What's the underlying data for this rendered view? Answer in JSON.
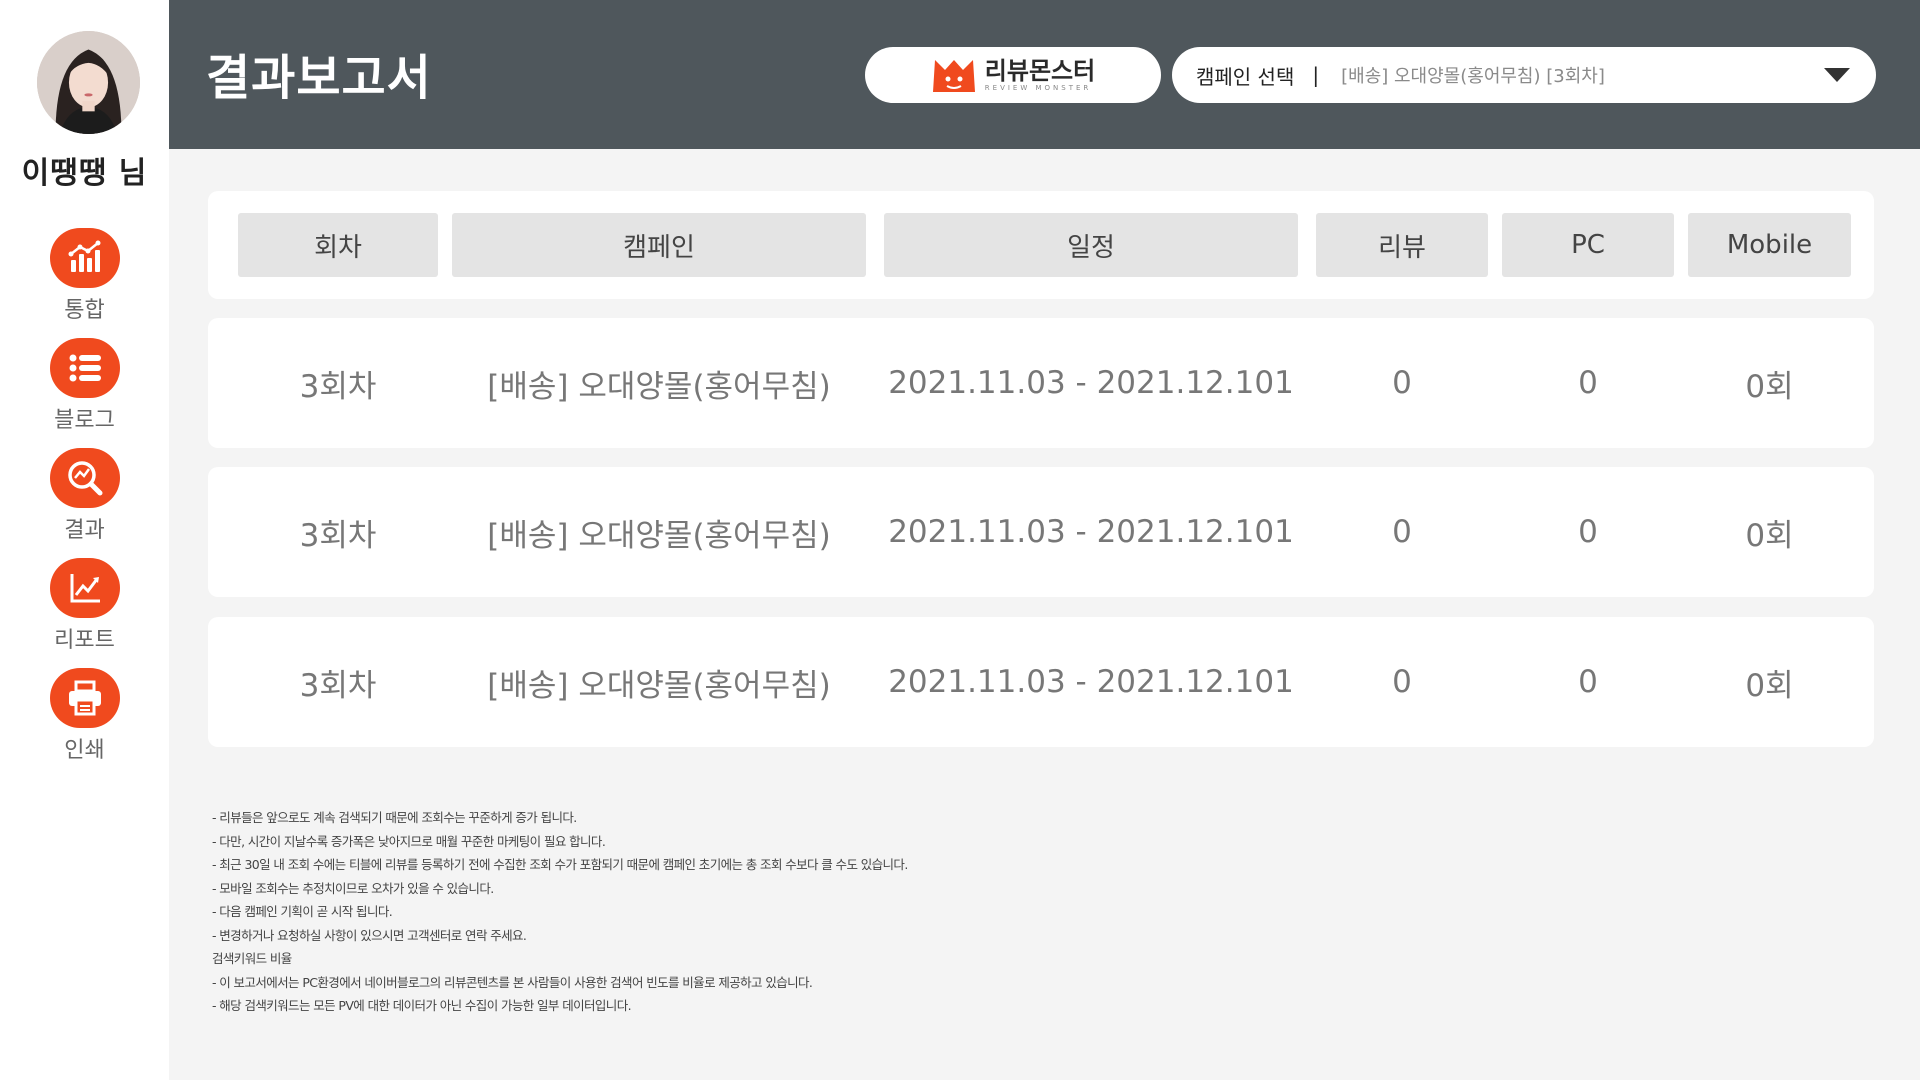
{
  "user": {
    "name": "이땡땡 님"
  },
  "nav": [
    {
      "label": "통합",
      "icon": "bar-chart-icon"
    },
    {
      "label": "블로그",
      "icon": "list-icon"
    },
    {
      "label": "결과",
      "icon": "search-analytics-icon"
    },
    {
      "label": "리포트",
      "icon": "line-chart-icon"
    },
    {
      "label": "인쇄",
      "icon": "printer-icon"
    }
  ],
  "header": {
    "title": "결과보고서",
    "logo_text": "리뷰몬스터",
    "logo_sub": "REVIEW MONSTER",
    "select_label": "캠페인 선택",
    "select_sep": "|",
    "select_value": "[배송] 오대양몰(홍어무침) [3회차]"
  },
  "table": {
    "columns": [
      "회차",
      "캠페인",
      "일정",
      "리뷰",
      "PC",
      "Mobile"
    ],
    "rows": [
      [
        "3회차",
        "[배송] 오대양몰(홍어무침)",
        "2021.11.03 - 2021.12.101",
        "0",
        "0",
        "0회"
      ],
      [
        "3회차",
        "[배송] 오대양몰(홍어무침)",
        "2021.11.03 - 2021.12.101",
        "0",
        "0",
        "0회"
      ],
      [
        "3회차",
        "[배송] 오대양몰(홍어무침)",
        "2021.11.03 - 2021.12.101",
        "0",
        "0",
        "0회"
      ]
    ]
  },
  "notes": [
    "- 리뷰들은 앞으로도 계속 검색되기 때문에 조회수는 꾸준하게 증가 됩니다.",
    "- 다만, 시간이 지날수록 증가폭은 낮아지므로 매월 꾸준한 마케팅이 필요 합니다.",
    "- 최근 30일 내 조회 수에는 티블에 리뷰를 등록하기 전에 수집한 조회 수가 포함되기 때문에 캠페인 초기에는 총 조회 수보다 클 수도 있습니다.",
    "- 모바일 조회수는 추정치이므로 오차가 있을 수 있습니다.",
    "- 다음 캠페인 기획이 곧 시작 됩니다.",
    "- 변경하거나 요청하실 사항이 있으시면 고객센터로 연락 주세요.",
    "검색키워드 비율",
    "- 이 보고서에서는 PC환경에서 네이버블로그의 리뷰콘텐츠를 본 사람들이 사용한 검색어 빈도를 비율로 제공하고 있습니다.",
    "- 해당 검색키워드는 모든 PV에 대한 데이터가 아닌 수집이 가능한 일부 데이터입니다."
  ],
  "colors": {
    "accent": "#f04a1e",
    "header_bg": "#4f575c",
    "page_bg": "#f4f4f4",
    "col_header_bg": "#e4e4e4"
  }
}
